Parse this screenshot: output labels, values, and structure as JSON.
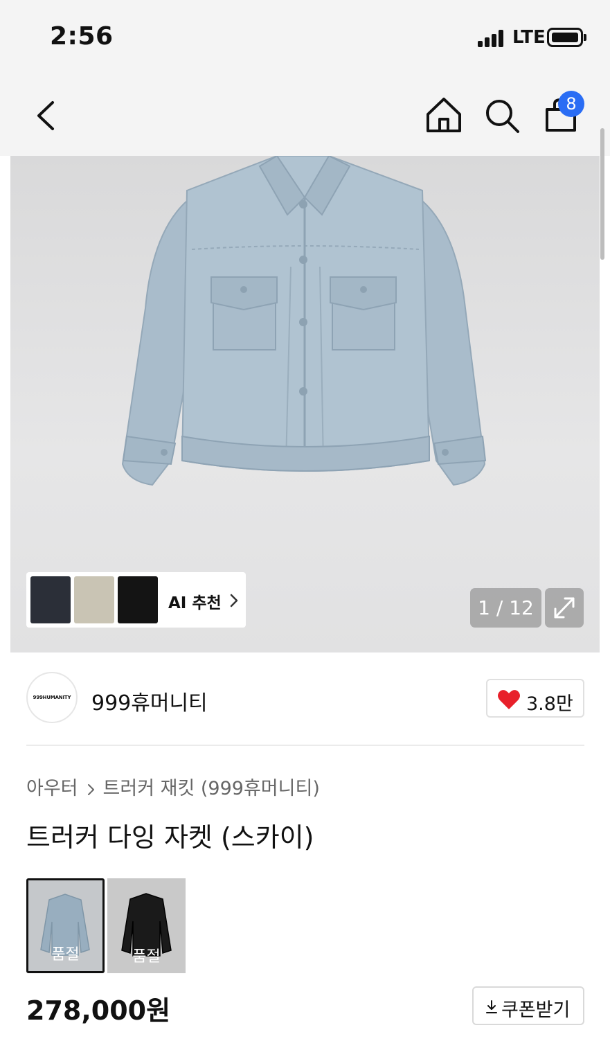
{
  "status_bar": {
    "time": "2:56",
    "network": "LTE",
    "battery_level": 0.85
  },
  "nav": {
    "back_icon": "chevron-left-icon",
    "home_icon": "home-icon",
    "search_icon": "search-icon",
    "cart_icon": "shopping-bag-icon",
    "cart_count": "8",
    "badge_color": "#2a6df4"
  },
  "gallery": {
    "current_page": "1",
    "total_pages": "12",
    "counter_text": "1 / 12",
    "expand_icon": "expand-icon",
    "main_image": "sky-blue-trucker-jacket",
    "ai_recommend": {
      "label": "AI 추천",
      "thumbnails": [
        "navy-jacket",
        "beige-jacket",
        "black-jacket"
      ]
    }
  },
  "brand": {
    "logo_text": "999HUMANITY",
    "name": "999휴머니티",
    "like_count": "3.8만",
    "like_icon": "heart-icon",
    "heart_color": "#e8202a"
  },
  "breadcrumb": {
    "items": [
      "아우터",
      "트러커 재킷 (999휴머니티)"
    ]
  },
  "product": {
    "title": "트러커 다잉 자켓 (스카이)",
    "price": "278,000원"
  },
  "variants": [
    {
      "name": "sky-jacket",
      "label": "품절",
      "selected": true
    },
    {
      "name": "black-jacket",
      "label": "품절",
      "selected": false
    }
  ],
  "coupon": {
    "label": "쿠폰받기",
    "icon": "download-icon"
  }
}
